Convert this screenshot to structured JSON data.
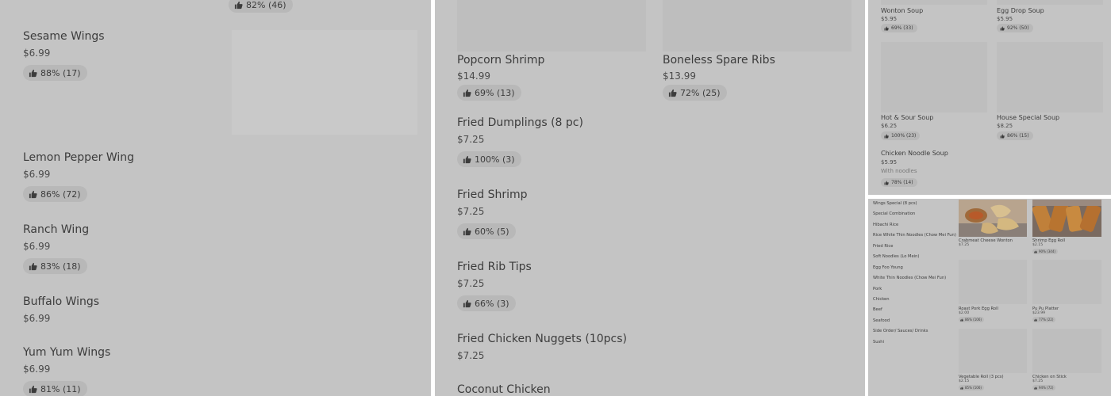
{
  "panel1": {
    "top_rating": "82% (46)",
    "items": [
      {
        "name": "Sesame Wings",
        "price": "$6.99",
        "rating": "88% (17)"
      },
      {
        "name": "Lemon Pepper Wing",
        "price": "$6.99",
        "rating": "86% (72)"
      },
      {
        "name": "Ranch Wing",
        "price": "$6.99",
        "rating": "83% (18)"
      },
      {
        "name": "Buffalo Wings",
        "price": "$6.99"
      },
      {
        "name": "Yum Yum Wings",
        "price": "$6.99",
        "rating": "81% (11)"
      }
    ]
  },
  "panel2": {
    "items": [
      {
        "name": "Popcorn Shrimp",
        "price": "$14.99",
        "rating": "69% (13)"
      },
      {
        "name": "Boneless Spare Ribs",
        "price": "$13.99",
        "rating": "72% (25)"
      },
      {
        "name": "Fried Dumplings (8 pc)",
        "price": "$7.25",
        "rating": "100% (3)"
      },
      {
        "name": "Fried Shrimp",
        "price": "$7.25",
        "rating": "60% (5)"
      },
      {
        "name": "Fried Rib Tips",
        "price": "$7.25",
        "rating": "66% (3)"
      },
      {
        "name": "Fried Chicken Nuggets (10pcs)",
        "price": "$7.25"
      },
      {
        "name": "Coconut Chicken"
      }
    ]
  },
  "panel3": {
    "items": [
      {
        "name": "Wonton Soup",
        "price": "$5.95",
        "rating": "69% (33)"
      },
      {
        "name": "Egg Drop Soup",
        "price": "$5.95",
        "rating": "92% (50)"
      },
      {
        "name": "Hot & Sour Soup",
        "price": "$6.25",
        "rating": "100% (23)"
      },
      {
        "name": "House Special Soup",
        "price": "$8.25",
        "rating": "86% (15)"
      },
      {
        "name": "Chicken Noodle Soup",
        "price": "$5.95",
        "description": "With noodles",
        "rating": "78% (14)"
      }
    ]
  },
  "panel4": {
    "categories": [
      "Wings Special (8 pcs)",
      "Special Combination",
      "Hibachi Rice",
      "Rice White Thin Noodles (Chow Mei Fun)",
      "Fried Rice",
      "Soft Noodles (Lo Mein)",
      "Egg Foo Young",
      "White Thin Noodles (Chow Mei Fun)",
      "Pork",
      "Chicken",
      "Beef",
      "Seafood",
      "Side Order/ Sauces/ Drinks",
      "Sushi"
    ],
    "items": [
      {
        "name": "Crabmeat Cheese Wonton",
        "price": "$7.25"
      },
      {
        "name": "Shrimp Egg Roll",
        "price": "$2.15",
        "rating": "90% (344)"
      },
      {
        "name": "Roast Pork Egg Roll",
        "price": "$2.00",
        "rating": "86% (106)"
      },
      {
        "name": "Pu Pu Platter",
        "price": "$23.99",
        "rating": "77% (22)"
      },
      {
        "name": "Vegetable Roll (3 pcs)",
        "price": "$2.15",
        "rating": "85% (106)"
      },
      {
        "name": "Chicken on Stick",
        "price": "$7.25",
        "rating": "94% (72)"
      }
    ]
  },
  "colors": {
    "overlay": "#c4c4c4",
    "pill": "#b8b8b8",
    "divider": "#ffffff"
  }
}
